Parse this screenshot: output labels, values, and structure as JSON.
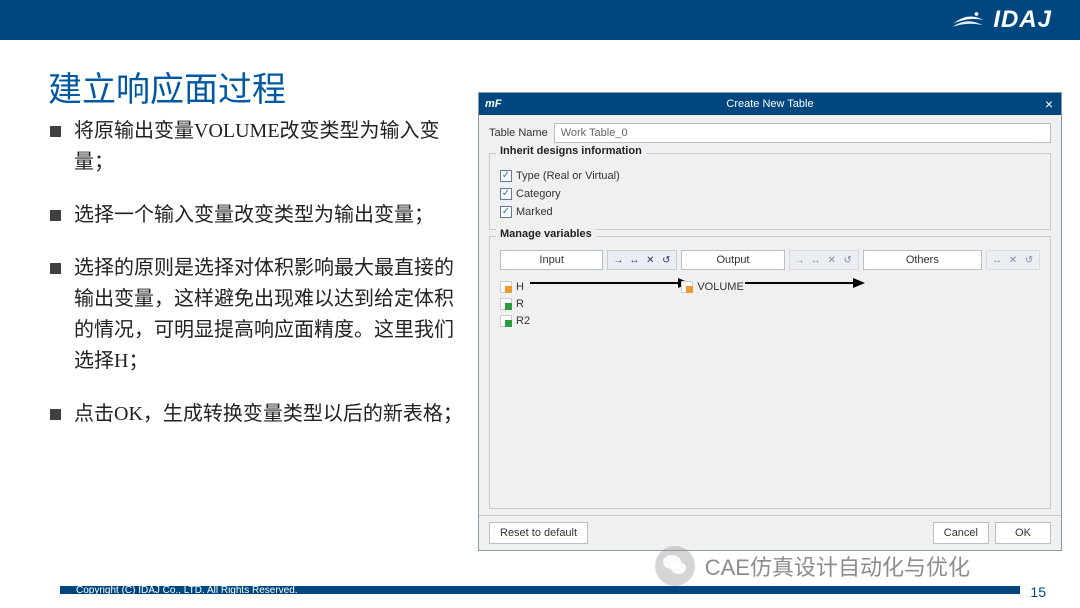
{
  "header": {
    "brand": "IDAJ"
  },
  "slide": {
    "title": "建立响应面过程",
    "bullets": [
      "将原输出变量VOLUME改变类型为输入变量；",
      "选择一个输入变量改变类型为输出变量；",
      "选择的原则是选择对体积影响最大最直接的输出变量，这样避免出现难以达到给定体积的情况，可明显提高响应面精度。这里我们选择H；",
      "点击OK，生成转换变量类型以后的新表格；"
    ]
  },
  "dialog": {
    "app_abbrev": "mF",
    "title": "Create New Table",
    "close_glyph": "×",
    "table_name_label": "Table Name",
    "table_name_value": "Work Table_0",
    "group_inherit": {
      "title": "Inherit designs information",
      "items": [
        {
          "label": "Type (Real or Virtual)",
          "checked": true
        },
        {
          "label": "Category",
          "checked": true
        },
        {
          "label": "Marked",
          "checked": true
        }
      ]
    },
    "group_manage": {
      "title": "Manage variables"
    },
    "columns": {
      "input": {
        "label": "Input",
        "vars": [
          "H",
          "R",
          "R2"
        ]
      },
      "output": {
        "label": "Output",
        "vars": [
          "VOLUME"
        ]
      },
      "others": {
        "label": "Others",
        "vars": []
      }
    },
    "buttons": {
      "reset": "Reset to default",
      "cancel": "Cancel",
      "ok": "OK"
    }
  },
  "footer": {
    "copyright": "Copyright (C)  IDAJ Co., LTD.  All Rights Reserved.",
    "page": "15"
  },
  "overlay": {
    "wechat_text": "CAE仿真设计自动化与优化"
  },
  "tool_glyphs": {
    "arrow_right": "→",
    "move": "↔",
    "del": "✕",
    "undo": "↺"
  }
}
